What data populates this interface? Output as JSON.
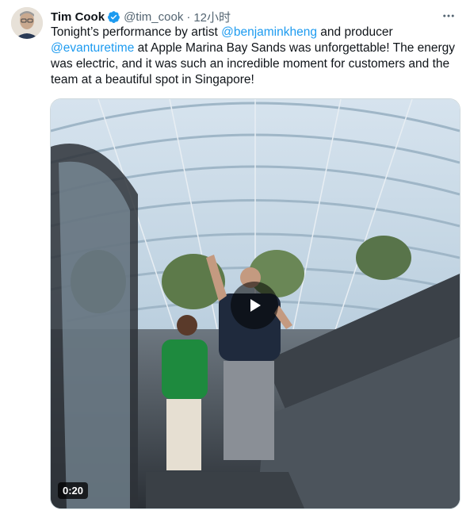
{
  "tweet": {
    "author_name": "Tim Cook",
    "handle": "@tim_cook",
    "separator": "·",
    "time": "12小时",
    "text_parts": [
      {
        "text": "Tonight’s performance by artist ",
        "type": "plain"
      },
      {
        "text": "@benjaminkheng",
        "type": "mention"
      },
      {
        "text": " and producer ",
        "type": "plain"
      },
      {
        "text": "@evanturetime",
        "type": "mention"
      },
      {
        "text": " at Apple Marina Bay Sands was unforgettable! The energy was electric, and it was such an incredible moment for customers and the team at a beautiful spot in Singapore!",
        "type": "plain"
      }
    ],
    "video_duration": "0:20"
  },
  "icons": {
    "verified": "verified-badge-icon",
    "more": "more-dots-icon",
    "play": "play-icon"
  },
  "colors": {
    "mention": "#1d9bf0",
    "verified": "#1d9bf0",
    "secondary_text": "#536471"
  }
}
